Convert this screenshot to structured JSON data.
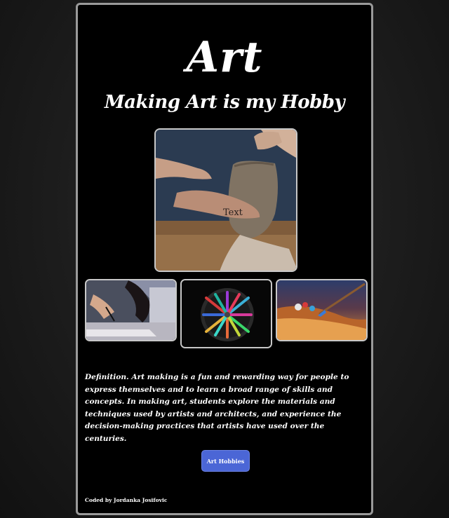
{
  "header": {
    "title": "Art",
    "subtitle": "Making Art is my Hobby"
  },
  "gallery": {
    "main_image": {
      "caption_text": "Text",
      "subject": "hands shaping clay pot"
    },
    "thumbnails": [
      {
        "subject": "person drawing with laptop"
      },
      {
        "subject": "colored pencils in a cup"
      },
      {
        "subject": "paintbrush on palette"
      }
    ]
  },
  "content": {
    "definition": "Definition. Art making is a fun and rewarding way for people to express themselves and to learn a broad range of skills and concepts. In making art, students explore the materials and techniques used by artists and architects, and experience the decision-making practices that artists have used over the centuries."
  },
  "actions": {
    "hobbies_button_label": "Art Hobbies"
  },
  "footer": {
    "credit": "Coded by Jordanka Josifovic"
  },
  "colors": {
    "card_background": "#000000",
    "card_border": "#9a9a9a",
    "button_accent": "#4b66d6",
    "text": "#ffffff"
  }
}
